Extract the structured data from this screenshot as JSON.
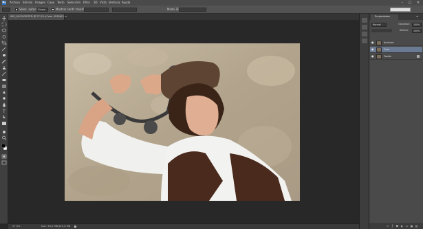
{
  "app": {
    "menus": [
      "Archivo",
      "Edición",
      "Imagen",
      "Capa",
      "Texto",
      "Selección",
      "Filtro",
      "3D",
      "Vista",
      "Ventana",
      "Ayuda"
    ],
    "window_controls": [
      "–",
      "□",
      "×"
    ]
  },
  "options_bar": {
    "auto_select_label": "Selec. autom.:",
    "auto_select_value": "Grupo",
    "show_transform_label": "Mostrar contr. transf.",
    "mode_3d_label": "Modo 3D:"
  },
  "document": {
    "tab_title": "IMG_0093-EDITED @ 27,5% (Color, RGB/8*) ×"
  },
  "status_bar": {
    "zoom": "27,5%",
    "doc_info": "Doc: 34,5 MB/125,6 MB"
  },
  "properties_panel": {
    "tab_label": "Propiedades",
    "kind_label": "Normal",
    "opacity_label": "Opacidad:",
    "opacity_value": "100%",
    "fill_label": "Relleno:",
    "fill_value": "100%"
  },
  "layers": [
    {
      "name": "Anchura",
      "selected": false
    },
    {
      "name": "Cara",
      "selected": true
    },
    {
      "name": "Fondo",
      "selected": false
    }
  ],
  "colors": {
    "selection": "#6a7a92",
    "background": "#282828"
  }
}
